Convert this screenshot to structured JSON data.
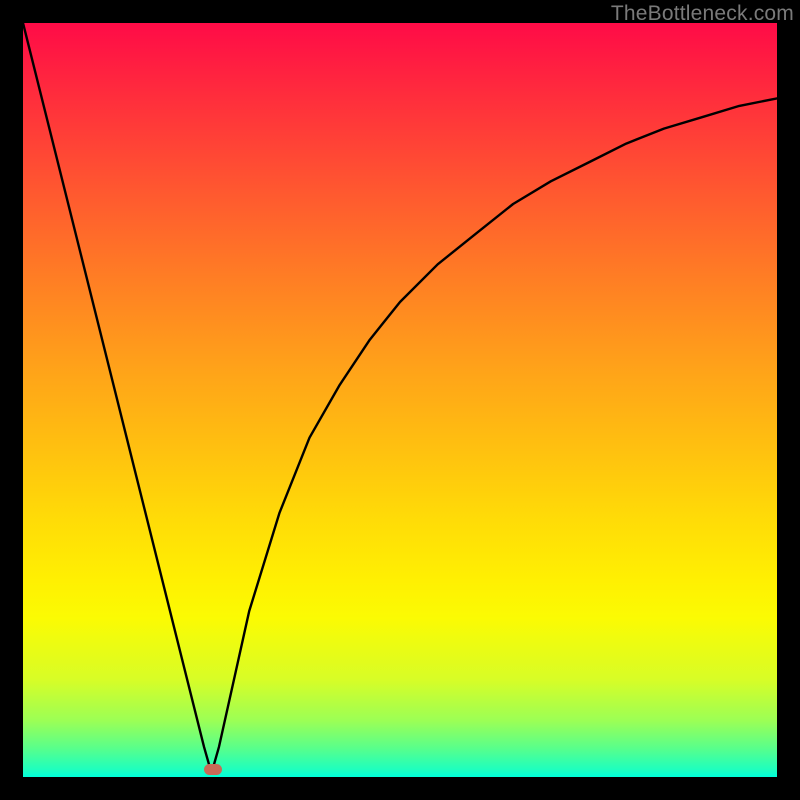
{
  "watermark": "TheBottleneck.com",
  "colors": {
    "page_bg": "#000000",
    "marker": "#c96a57",
    "curve": "#000000",
    "gradient_stops": [
      "#ff0b47",
      "#ff2e3c",
      "#ff5730",
      "#ff7e24",
      "#ffa319",
      "#ffc20f",
      "#ffdc07",
      "#fff002",
      "#fbfb03",
      "#d8fd26",
      "#9cff55",
      "#5cff88",
      "#1effbe",
      "#00ffdb"
    ]
  },
  "chart_data": {
    "type": "line",
    "title": "",
    "xlabel": "",
    "ylabel": "",
    "x_range": [
      0,
      100
    ],
    "y_range": [
      0,
      100
    ],
    "note": "V-shaped curve: steep linear descent on the left limb, sharp minimum near x≈25, rising asymptotic limb on the right approaching y≈90 at the right edge. Values read off by pixel position relative to the 754×754 plot area (y=0 at bottom, y=100 at top).",
    "series": [
      {
        "name": "curve",
        "x": [
          0,
          5,
          10,
          15,
          20,
          24,
          25,
          26,
          28,
          30,
          34,
          38,
          42,
          46,
          50,
          55,
          60,
          65,
          70,
          75,
          80,
          85,
          90,
          95,
          100
        ],
        "y": [
          100,
          80,
          60,
          40,
          20,
          4,
          0.5,
          4,
          13,
          22,
          35,
          45,
          52,
          58,
          63,
          68,
          72,
          76,
          79,
          81.5,
          84,
          86,
          87.5,
          89,
          90
        ]
      }
    ],
    "marker": {
      "x": 25,
      "y": 0.5,
      "color": "#c96a57"
    }
  }
}
